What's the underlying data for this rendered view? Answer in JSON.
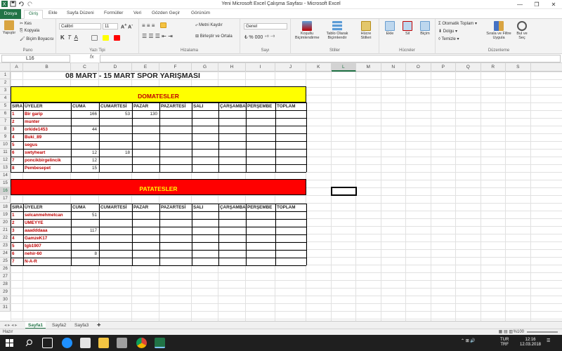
{
  "window": {
    "title": "Yeni Microsoft Excel Çalışma Sayfası  -  Microsoft Excel",
    "controls": [
      "—",
      "❐",
      "✕"
    ]
  },
  "tabs": [
    "Dosya",
    "Giriş",
    "Ekle",
    "Sayfa Düzeni",
    "Formüller",
    "Veri",
    "Gözden Geçir",
    "Görünüm"
  ],
  "ribbon": {
    "clipboard": {
      "paste": "Yapıştır",
      "cut": "Kes",
      "copy": "Kopyala",
      "painter": "Biçim Boyacısı",
      "label": "Pano"
    },
    "font": {
      "name": "Calibri",
      "size": "11",
      "label": "Yazı Tipi"
    },
    "alignment": {
      "wrap": "Metni Kaydır",
      "merge": "Birleştir ve Ortala",
      "label": "Hizalama"
    },
    "number": {
      "format": "Genel",
      "label": "Sayı"
    },
    "styles": {
      "cond": "Koşullu Biçimlendirme",
      "table": "Tablo Olarak Biçimlendir",
      "cell": "Hücre Stilleri",
      "label": "Stiller"
    },
    "cells": {
      "insert": "Ekle",
      "delete": "Sil",
      "format": "Biçim",
      "label": "Hücreler"
    },
    "editing": {
      "autosum": "Otomatik Toplam",
      "fill": "Dolgu",
      "clear": "Temizle",
      "sort": "Sırala ve Filtre Uygula",
      "find": "Bul ve Seç",
      "label": "Düzenleme"
    }
  },
  "formula_bar": {
    "name_box": "L16",
    "fx": "fx",
    "value": ""
  },
  "columns": [
    "A",
    "B",
    "C",
    "D",
    "E",
    "F",
    "G",
    "H",
    "I",
    "J",
    "K",
    "L",
    "M",
    "N",
    "O",
    "P",
    "Q",
    "R",
    "S"
  ],
  "rows": [
    "1",
    "2",
    "3",
    "4",
    "5",
    "6",
    "7",
    "8",
    "9",
    "10",
    "11",
    "12",
    "13",
    "14",
    "15",
    "16",
    "17",
    "18",
    "19",
    "20",
    "21",
    "22",
    "23",
    "24",
    "25",
    "26",
    "27",
    "28",
    "29",
    "30",
    "31"
  ],
  "selected": {
    "col": "L",
    "row": "16"
  },
  "sheet": {
    "title": "08 MART - 15 MART SPOR YARIŞMASI",
    "headers": [
      "SIRA NO",
      "ÜYELER",
      "CUMA",
      "CUMARTESİ",
      "PAZAR",
      "PAZARTESİ",
      "SALI",
      "ÇARŞAMBA",
      "PERŞEMBE",
      "TOPLAM"
    ],
    "section1": {
      "title": "DOMATESLER",
      "rows": [
        {
          "no": "1",
          "name": "Bir garip",
          "cuma": "166",
          "cmt": "53",
          "pazar": "130"
        },
        {
          "no": "2",
          "name": "munter",
          "cuma": "",
          "cmt": "",
          "pazar": ""
        },
        {
          "no": "3",
          "name": "orkide1453",
          "cuma": "44",
          "cmt": "",
          "pazar": ""
        },
        {
          "no": "4",
          "name": "Buki_89",
          "cuma": "",
          "cmt": "",
          "pazar": ""
        },
        {
          "no": "5",
          "name": "segus",
          "cuma": "",
          "cmt": "",
          "pazar": ""
        },
        {
          "no": "6",
          "name": "swtyheart",
          "cuma": "12",
          "cmt": "18",
          "pazar": ""
        },
        {
          "no": "7",
          "name": "poncikbirgelincik",
          "cuma": "12",
          "cmt": "",
          "pazar": ""
        },
        {
          "no": "8",
          "name": "Pembesepet",
          "cuma": "15",
          "cmt": "",
          "pazar": ""
        }
      ]
    },
    "section2": {
      "title": "PATATESLER",
      "rows": [
        {
          "no": "1",
          "name": "selcanmehmetcan",
          "cuma": "51"
        },
        {
          "no": "2",
          "name": "UMEYYE",
          "cuma": ""
        },
        {
          "no": "3",
          "name": "aaadddaaa",
          "cuma": "117"
        },
        {
          "no": "4",
          "name": "GamzeK17",
          "cuma": ""
        },
        {
          "no": "5",
          "name": "tgb1907",
          "cuma": ""
        },
        {
          "no": "6",
          "name": "nehir-60",
          "cuma": "8"
        },
        {
          "no": "7",
          "name": "N-A-R",
          "cuma": ""
        }
      ]
    }
  },
  "sheet_tabs": [
    "Sayfa1",
    "Sayfa2",
    "Sayfa3"
  ],
  "status": {
    "ready": "Hazır",
    "zoom": "%100"
  },
  "taskbar": {
    "lang": "TUR",
    "lang2": "TRF",
    "time": "12:16",
    "date": "12.03.2018"
  },
  "colors": {
    "yellow": "#ffff00",
    "red_band": "#ff0000",
    "accent": "#217346"
  }
}
